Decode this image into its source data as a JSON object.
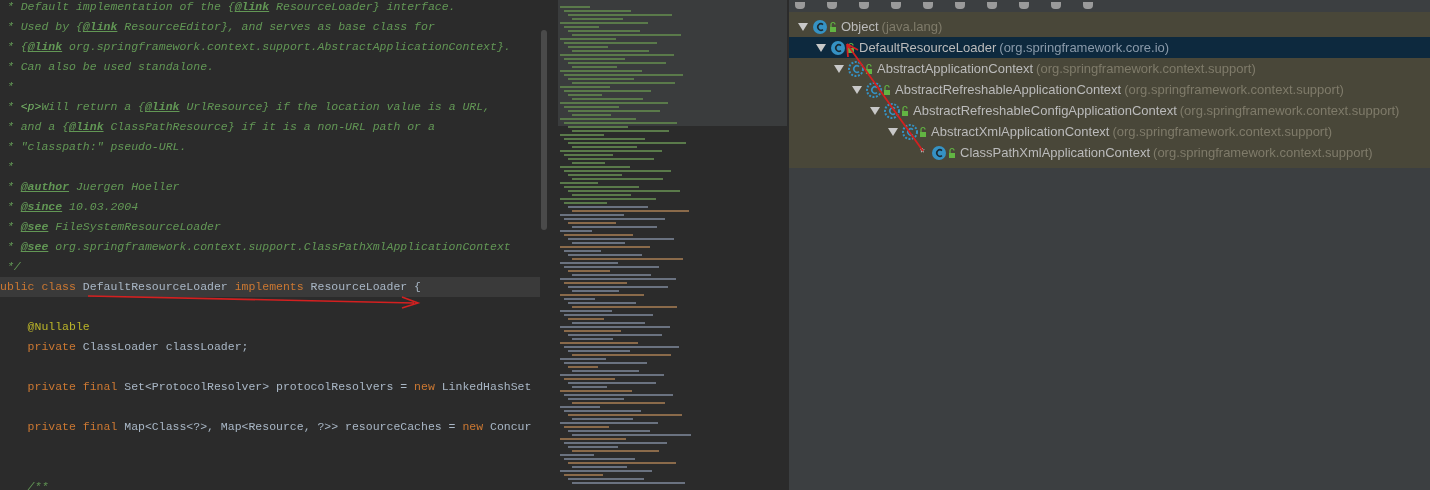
{
  "editor": {
    "lines": [
      {
        "kind": "code",
        "current": false,
        "tokens": [
          {
            "kind": "star",
            "text": " * "
          },
          {
            "kind": "doc",
            "text": "Default implementation of the {"
          },
          {
            "kind": "tag",
            "text": "@link"
          },
          {
            "kind": "doc",
            "text": " ResourceLoader} interface."
          }
        ]
      },
      {
        "kind": "code",
        "current": false,
        "tokens": [
          {
            "kind": "star",
            "text": " * "
          },
          {
            "kind": "doc",
            "text": "Used by {"
          },
          {
            "kind": "tag",
            "text": "@link"
          },
          {
            "kind": "doc",
            "text": " ResourceEditor}, and serves as base class for"
          }
        ]
      },
      {
        "kind": "code",
        "current": false,
        "tokens": [
          {
            "kind": "star",
            "text": " * "
          },
          {
            "kind": "doc",
            "text": "{"
          },
          {
            "kind": "tag",
            "text": "@link"
          },
          {
            "kind": "doc",
            "text": " org.springframework.context.support.AbstractApplicationContext}."
          }
        ]
      },
      {
        "kind": "code",
        "current": false,
        "tokens": [
          {
            "kind": "star",
            "text": " * "
          },
          {
            "kind": "doc",
            "text": "Can also be used standalone."
          }
        ]
      },
      {
        "kind": "code",
        "current": false,
        "tokens": [
          {
            "kind": "star",
            "text": " *"
          }
        ]
      },
      {
        "kind": "code",
        "current": false,
        "tokens": [
          {
            "kind": "star",
            "text": " * "
          },
          {
            "kind": "html",
            "text": "<p>"
          },
          {
            "kind": "doc",
            "text": "Will return a {"
          },
          {
            "kind": "tag",
            "text": "@link"
          },
          {
            "kind": "doc",
            "text": " UrlResource} if the location value is a URL,"
          }
        ]
      },
      {
        "kind": "code",
        "current": false,
        "tokens": [
          {
            "kind": "star",
            "text": " * "
          },
          {
            "kind": "doc",
            "text": "and a {"
          },
          {
            "kind": "tag",
            "text": "@link"
          },
          {
            "kind": "doc",
            "text": " ClassPathResource} if it is a non-URL path or a"
          }
        ]
      },
      {
        "kind": "code",
        "current": false,
        "tokens": [
          {
            "kind": "star",
            "text": " * "
          },
          {
            "kind": "doc",
            "text": "\"classpath:\" pseudo-URL."
          }
        ]
      },
      {
        "kind": "code",
        "current": false,
        "tokens": [
          {
            "kind": "star",
            "text": " *"
          }
        ]
      },
      {
        "kind": "code",
        "current": false,
        "tokens": [
          {
            "kind": "star",
            "text": " * "
          },
          {
            "kind": "tag",
            "text": "@author"
          },
          {
            "kind": "doc",
            "text": " Juergen Hoeller"
          }
        ]
      },
      {
        "kind": "code",
        "current": false,
        "tokens": [
          {
            "kind": "star",
            "text": " * "
          },
          {
            "kind": "tag",
            "text": "@since"
          },
          {
            "kind": "doc",
            "text": " 10.03.2004"
          }
        ]
      },
      {
        "kind": "code",
        "current": false,
        "tokens": [
          {
            "kind": "star",
            "text": " * "
          },
          {
            "kind": "tag",
            "text": "@see"
          },
          {
            "kind": "doc",
            "text": " FileSystemResourceLoader"
          }
        ]
      },
      {
        "kind": "code",
        "current": false,
        "tokens": [
          {
            "kind": "star",
            "text": " * "
          },
          {
            "kind": "tag",
            "text": "@see"
          },
          {
            "kind": "doc",
            "text": " org.springframework.context.support.ClassPathXmlApplicationContext"
          }
        ]
      },
      {
        "kind": "code",
        "current": false,
        "tokens": [
          {
            "kind": "star",
            "text": " */"
          }
        ]
      },
      {
        "kind": "code",
        "current": true,
        "tokens": [
          {
            "kind": "keyword",
            "text": "ublic class "
          },
          {
            "kind": "plain",
            "text": "DefaultResourceLoader "
          },
          {
            "kind": "keyword",
            "text": "implements "
          },
          {
            "kind": "plain",
            "text": "ResourceLoader {"
          }
        ]
      },
      {
        "kind": "blank",
        "current": false
      },
      {
        "kind": "code",
        "current": false,
        "tokens": [
          {
            "kind": "annotation",
            "text": "    @Nullable"
          }
        ]
      },
      {
        "kind": "code",
        "current": false,
        "tokens": [
          {
            "kind": "keyword",
            "text": "    private "
          },
          {
            "kind": "plain",
            "text": "ClassLoader classLoader;"
          }
        ]
      },
      {
        "kind": "blank",
        "current": false
      },
      {
        "kind": "code",
        "current": false,
        "tokens": [
          {
            "kind": "keyword",
            "text": "    private final "
          },
          {
            "kind": "plain",
            "text": "Set<ProtocolResolver> protocolResolvers = "
          },
          {
            "kind": "keyword",
            "text": "new "
          },
          {
            "kind": "plain",
            "text": "LinkedHashSet"
          }
        ]
      },
      {
        "kind": "blank",
        "current": false
      },
      {
        "kind": "code",
        "current": false,
        "tokens": [
          {
            "kind": "keyword",
            "text": "    private final "
          },
          {
            "kind": "plain",
            "text": "Map<Class<?>, Map<Resource, ?>> resourceCaches = "
          },
          {
            "kind": "keyword",
            "text": "new "
          },
          {
            "kind": "plain",
            "text": "Concur"
          }
        ]
      },
      {
        "kind": "blank",
        "current": false
      },
      {
        "kind": "blank",
        "current": false
      },
      {
        "kind": "code",
        "current": false,
        "tokens": [
          {
            "kind": "star",
            "text": "    /**"
          }
        ]
      }
    ]
  },
  "hierarchy": {
    "tree": [
      {
        "name": "Object",
        "package": "(java.lang)",
        "abstract": false,
        "selected": false,
        "expanded": true,
        "children": [
          {
            "name": "DefaultResourceLoader",
            "package": "(org.springframework.core.io)",
            "abstract": false,
            "selected": true,
            "expanded": true,
            "children": [
              {
                "name": "AbstractApplicationContext",
                "package": "(org.springframework.context.support)",
                "abstract": true,
                "selected": false,
                "expanded": true,
                "children": [
                  {
                    "name": "AbstractRefreshableApplicationContext",
                    "package": "(org.springframework.context.support)",
                    "abstract": true,
                    "selected": false,
                    "expanded": true,
                    "children": [
                      {
                        "name": "AbstractRefreshableConfigApplicationContext",
                        "package": "(org.springframework.context.support)",
                        "abstract": true,
                        "selected": false,
                        "expanded": true,
                        "children": [
                          {
                            "name": "AbstractXmlApplicationContext",
                            "package": "(org.springframework.context.support)",
                            "abstract": true,
                            "selected": false,
                            "expanded": true,
                            "children": [
                              {
                                "name": "ClassPathXmlApplicationContext",
                                "package": "(org.springframework.context.support)",
                                "mark": "*",
                                "abstract": false,
                                "selected": false
                              }
                            ]
                          }
                        ]
                      }
                    ]
                  }
                ]
              }
            ]
          }
        ]
      }
    ]
  }
}
